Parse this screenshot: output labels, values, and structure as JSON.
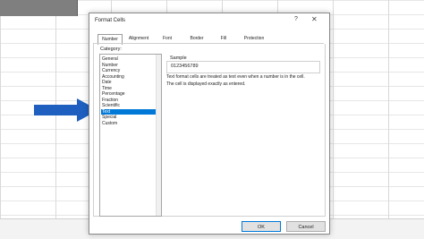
{
  "dialog": {
    "title": "Format Cells",
    "help": "?",
    "close": "✕",
    "tabs": [
      {
        "label": "Number"
      },
      {
        "label": "Alignment"
      },
      {
        "label": "Font"
      },
      {
        "label": "Border"
      },
      {
        "label": "Fill"
      },
      {
        "label": "Protection"
      }
    ],
    "category_label": "Category:",
    "categories": [
      "General",
      "Number",
      "Currency",
      "Accounting",
      "Date",
      "Time",
      "Percentage",
      "Fraction",
      "Scientific",
      "Text",
      "Special",
      "Custom"
    ],
    "selected_category": "Text",
    "sample_label": "Sample",
    "sample_value": "0123456789",
    "description_lines": [
      "Text format cells are treated as text even when a number is in the cell.",
      "The cell is displayed exactly as entered."
    ],
    "ok_label": "OK",
    "cancel_label": "Cancel"
  },
  "colors": {
    "selection": "#0078d7",
    "arrow": "#1f5fbf"
  }
}
